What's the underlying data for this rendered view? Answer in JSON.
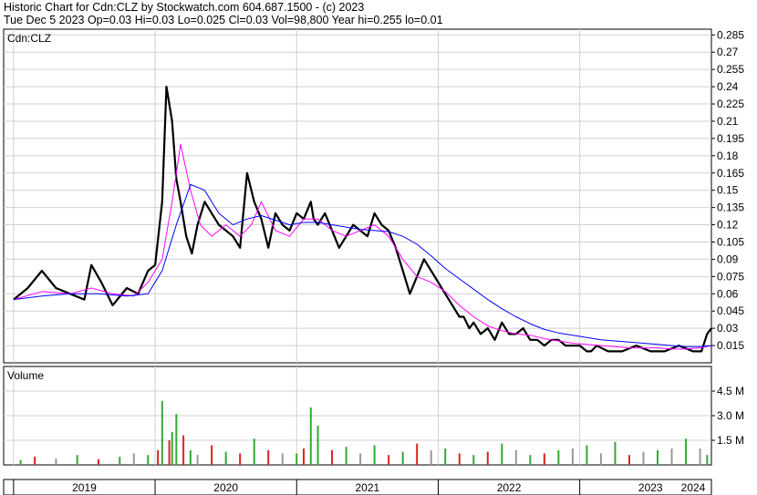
{
  "header": {
    "line1": "Historic Chart for Cdn:CLZ by Stockwatch.com 604.687.1500 - (c) 2023",
    "line2": "Tue Dec  5 2023  Op=0.03  Hi=0.03  Lo=0.025  Cl=0.03  Vol=98,800  Year hi=0.255  lo=0.01"
  },
  "chart_data": {
    "type": "line",
    "symbol_label": "Cdn:CLZ",
    "volume_label": "Volume",
    "price_ticks": [
      "0.285",
      "0.27",
      "0.255",
      "0.24",
      "0.225",
      "0.21",
      "0.195",
      "0.18",
      "0.165",
      "0.15",
      "0.135",
      "0.12",
      "0.105",
      "0.09",
      "0.075",
      "0.06",
      "0.045",
      "0.03",
      "0.015"
    ],
    "volume_ticks": [
      "4.5 M",
      "3.0 M",
      "1.5 M"
    ],
    "x_ticks": [
      "2019",
      "2020",
      "2021",
      "2022",
      "2023",
      "2024"
    ],
    "ylim": [
      0,
      0.29
    ],
    "volume_ylim": [
      0,
      6000000
    ],
    "xlim": [
      2018.93,
      2023.93
    ],
    "grid": true,
    "colors": {
      "price": "#000000",
      "ma_short": "#ff00ff",
      "ma_long": "#0000ff",
      "vol_up": "#33aa33",
      "vol_down": "#dd2222",
      "vol_flat": "#999999"
    },
    "series": [
      {
        "key": "close",
        "x": [
          2019.0,
          2019.1,
          2019.2,
          2019.3,
          2019.4,
          2019.5,
          2019.55,
          2019.62,
          2019.7,
          2019.8,
          2019.88,
          2019.95,
          2020.0,
          2020.05,
          2020.08,
          2020.12,
          2020.15,
          2020.18,
          2020.22,
          2020.26,
          2020.3,
          2020.35,
          2020.4,
          2020.45,
          2020.5,
          2020.55,
          2020.6,
          2020.65,
          2020.7,
          2020.75,
          2020.8,
          2020.85,
          2020.9,
          2020.95,
          2021.0,
          2021.05,
          2021.1,
          2021.12,
          2021.15,
          2021.2,
          2021.25,
          2021.3,
          2021.35,
          2021.4,
          2021.45,
          2021.5,
          2021.55,
          2021.6,
          2021.65,
          2021.7,
          2021.75,
          2021.8,
          2021.85,
          2021.9,
          2021.95,
          2022.0,
          2022.05,
          2022.1,
          2022.15,
          2022.18,
          2022.22,
          2022.25,
          2022.3,
          2022.35,
          2022.4,
          2022.45,
          2022.5,
          2022.55,
          2022.6,
          2022.65,
          2022.7,
          2022.75,
          2022.8,
          2022.85,
          2022.9,
          2022.95,
          2023.0,
          2023.05,
          2023.08,
          2023.12,
          2023.2,
          2023.3,
          2023.4,
          2023.5,
          2023.6,
          2023.7,
          2023.8,
          2023.86,
          2023.9,
          2023.93
        ],
        "y": [
          0.055,
          0.065,
          0.08,
          0.065,
          0.06,
          0.055,
          0.085,
          0.07,
          0.05,
          0.065,
          0.06,
          0.08,
          0.085,
          0.14,
          0.24,
          0.21,
          0.16,
          0.14,
          0.11,
          0.095,
          0.12,
          0.14,
          0.13,
          0.12,
          0.115,
          0.11,
          0.1,
          0.165,
          0.14,
          0.125,
          0.1,
          0.13,
          0.12,
          0.115,
          0.13,
          0.125,
          0.14,
          0.125,
          0.12,
          0.13,
          0.115,
          0.1,
          0.11,
          0.12,
          0.115,
          0.11,
          0.13,
          0.12,
          0.115,
          0.1,
          0.08,
          0.06,
          0.075,
          0.09,
          0.08,
          0.07,
          0.06,
          0.05,
          0.04,
          0.04,
          0.03,
          0.035,
          0.025,
          0.03,
          0.02,
          0.035,
          0.025,
          0.025,
          0.03,
          0.02,
          0.02,
          0.015,
          0.02,
          0.02,
          0.015,
          0.015,
          0.015,
          0.01,
          0.01,
          0.015,
          0.01,
          0.01,
          0.015,
          0.01,
          0.01,
          0.015,
          0.01,
          0.01,
          0.025,
          0.03
        ]
      },
      {
        "key": "ma_short",
        "x": [
          2019.0,
          2019.2,
          2019.4,
          2019.55,
          2019.7,
          2019.85,
          2019.95,
          2020.05,
          2020.12,
          2020.18,
          2020.25,
          2020.32,
          2020.4,
          2020.5,
          2020.6,
          2020.68,
          2020.75,
          2020.85,
          2020.95,
          2021.05,
          2021.15,
          2021.25,
          2021.35,
          2021.45,
          2021.55,
          2021.65,
          2021.75,
          2021.85,
          2021.95,
          2022.05,
          2022.15,
          2022.25,
          2022.35,
          2022.45,
          2022.55,
          2022.65,
          2022.75,
          2022.85,
          2022.95,
          2023.05,
          2023.15,
          2023.25,
          2023.35,
          2023.45,
          2023.55,
          2023.65,
          2023.75,
          2023.85,
          2023.93
        ],
        "y": [
          0.055,
          0.062,
          0.06,
          0.065,
          0.06,
          0.058,
          0.07,
          0.09,
          0.14,
          0.19,
          0.15,
          0.12,
          0.11,
          0.12,
          0.11,
          0.12,
          0.14,
          0.115,
          0.11,
          0.125,
          0.125,
          0.115,
          0.11,
          0.115,
          0.12,
          0.11,
          0.09,
          0.075,
          0.07,
          0.062,
          0.05,
          0.04,
          0.032,
          0.028,
          0.025,
          0.024,
          0.021,
          0.019,
          0.017,
          0.016,
          0.015,
          0.014,
          0.013,
          0.013,
          0.013,
          0.012,
          0.012,
          0.013,
          0.015
        ]
      },
      {
        "key": "ma_long",
        "x": [
          2019.0,
          2019.2,
          2019.4,
          2019.6,
          2019.8,
          2019.95,
          2020.05,
          2020.15,
          2020.25,
          2020.35,
          2020.45,
          2020.55,
          2020.65,
          2020.75,
          2020.85,
          2020.95,
          2021.05,
          2021.15,
          2021.25,
          2021.35,
          2021.45,
          2021.55,
          2021.65,
          2021.75,
          2021.85,
          2021.95,
          2022.05,
          2022.15,
          2022.25,
          2022.35,
          2022.45,
          2022.55,
          2022.65,
          2022.75,
          2022.85,
          2022.95,
          2023.05,
          2023.15,
          2023.25,
          2023.35,
          2023.45,
          2023.55,
          2023.65,
          2023.75,
          2023.85,
          2023.93
        ],
        "y": [
          0.055,
          0.058,
          0.06,
          0.06,
          0.058,
          0.06,
          0.08,
          0.12,
          0.155,
          0.15,
          0.13,
          0.12,
          0.125,
          0.128,
          0.124,
          0.12,
          0.122,
          0.122,
          0.12,
          0.118,
          0.116,
          0.115,
          0.114,
          0.11,
          0.103,
          0.093,
          0.082,
          0.073,
          0.064,
          0.055,
          0.047,
          0.04,
          0.034,
          0.029,
          0.026,
          0.024,
          0.022,
          0.02,
          0.019,
          0.018,
          0.017,
          0.016,
          0.015,
          0.014,
          0.014,
          0.015
        ]
      }
    ],
    "volume": {
      "x": [
        2019.05,
        2019.15,
        2019.3,
        2019.45,
        2019.6,
        2019.75,
        2019.85,
        2019.95,
        2020.02,
        2020.05,
        2020.1,
        2020.12,
        2020.15,
        2020.2,
        2020.25,
        2020.3,
        2020.4,
        2020.5,
        2020.6,
        2020.7,
        2020.8,
        2020.9,
        2021.0,
        2021.05,
        2021.1,
        2021.15,
        2021.25,
        2021.35,
        2021.45,
        2021.55,
        2021.65,
        2021.75,
        2021.85,
        2021.95,
        2022.05,
        2022.15,
        2022.25,
        2022.35,
        2022.45,
        2022.55,
        2022.65,
        2022.75,
        2022.85,
        2022.95,
        2023.05,
        2023.15,
        2023.25,
        2023.35,
        2023.45,
        2023.55,
        2023.65,
        2023.75,
        2023.85,
        2023.9
      ],
      "v": [
        300000,
        500000,
        400000,
        600000,
        350000,
        500000,
        700000,
        600000,
        900000,
        3900000,
        1500000,
        2000000,
        3100000,
        1800000,
        900000,
        600000,
        1200000,
        800000,
        700000,
        1600000,
        900000,
        700000,
        700000,
        1000000,
        3500000,
        2400000,
        900000,
        1100000,
        700000,
        1200000,
        600000,
        800000,
        1300000,
        900000,
        1000000,
        700000,
        600000,
        800000,
        1300000,
        900000,
        600000,
        700000,
        900000,
        1000000,
        1200000,
        700000,
        1400000,
        600000,
        800000,
        900000,
        1000000,
        1600000,
        1000000,
        600000
      ],
      "dir": [
        "up",
        "down",
        "flat",
        "up",
        "down",
        "up",
        "flat",
        "up",
        "down",
        "up",
        "down",
        "up",
        "up",
        "down",
        "up",
        "flat",
        "down",
        "up",
        "down",
        "up",
        "down",
        "flat",
        "up",
        "down",
        "up",
        "up",
        "down",
        "up",
        "flat",
        "up",
        "down",
        "up",
        "down",
        "flat",
        "up",
        "down",
        "up",
        "down",
        "up",
        "flat",
        "up",
        "down",
        "up",
        "flat",
        "up",
        "flat",
        "up",
        "down",
        "flat",
        "up",
        "flat",
        "up",
        "flat",
        "up"
      ]
    }
  }
}
